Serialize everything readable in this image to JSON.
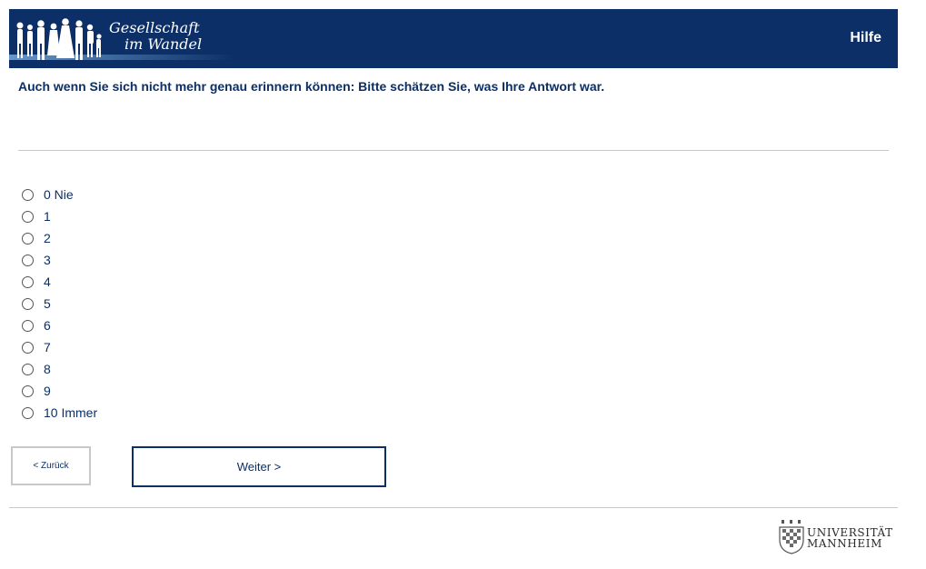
{
  "header": {
    "logo_line1": "Gesellschaft",
    "logo_line2": "im Wandel",
    "help_label": "Hilfe",
    "background": "#0b2f66"
  },
  "question": "Auch wenn Sie sich nicht mehr genau erinnern können: Bitte schätzen Sie, was Ihre Antwort war.",
  "options": [
    {
      "label": "0 Nie"
    },
    {
      "label": "1"
    },
    {
      "label": "2"
    },
    {
      "label": "3"
    },
    {
      "label": "4"
    },
    {
      "label": "5"
    },
    {
      "label": "6"
    },
    {
      "label": "7"
    },
    {
      "label": "8"
    },
    {
      "label": "9"
    },
    {
      "label": "10 Immer"
    }
  ],
  "nav": {
    "back_label": "< Zurück",
    "next_label": "Weiter >"
  },
  "footer": {
    "university_line1": "UNIVERSITÄT",
    "university_line2": "MANNHEIM",
    "seal_icon": "university-seal-icon"
  }
}
